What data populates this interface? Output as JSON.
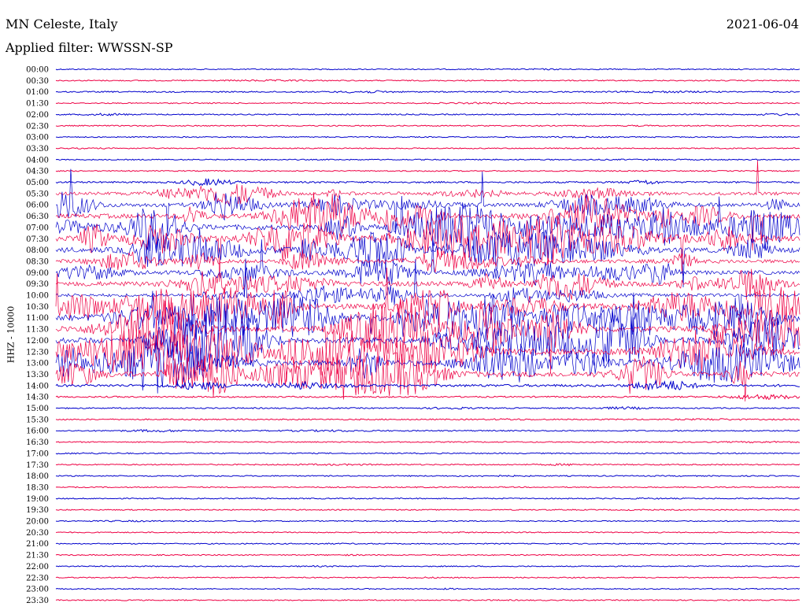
{
  "header": {
    "station": "MN Celeste, Italy",
    "filter": "Applied filter: WWSSN-SP",
    "date": "2021-06-04"
  },
  "chart_data": {
    "type": "line",
    "title": "MN Celeste, Italy",
    "subtitle": "Applied filter: WWSSN-SP",
    "date": "2021-06-04",
    "ylabel": "HHZ - 10000",
    "row_labels": [
      "00:00",
      "00:30",
      "01:00",
      "01:30",
      "02:00",
      "02:30",
      "03:00",
      "03:30",
      "04:00",
      "04:30",
      "05:00",
      "05:30",
      "06:00",
      "06:30",
      "07:00",
      "07:30",
      "08:00",
      "08:30",
      "09:00",
      "09:30",
      "10:00",
      "10:30",
      "11:00",
      "11:30",
      "12:00",
      "12:30",
      "13:00",
      "13:30",
      "14:00",
      "14:30",
      "15:00",
      "15:30",
      "16:00",
      "16:30",
      "17:00",
      "17:30",
      "18:00",
      "18:30",
      "19:00",
      "19:30",
      "20:00",
      "20:30",
      "21:00",
      "21:30",
      "22:00",
      "22:30",
      "23:00",
      "23:30"
    ],
    "row_activity": [
      0.02,
      0.03,
      0.06,
      0.02,
      0.05,
      0.03,
      0.02,
      0.02,
      0.02,
      0.02,
      0.15,
      0.45,
      0.6,
      0.75,
      0.9,
      0.9,
      0.85,
      0.55,
      0.6,
      0.8,
      0.45,
      0.95,
      1.0,
      1.0,
      1.0,
      1.0,
      0.95,
      0.9,
      0.3,
      0.1,
      0.05,
      0.05,
      0.05,
      0.03,
      0.03,
      0.04,
      0.03,
      0.02,
      0.03,
      0.02,
      0.03,
      0.02,
      0.02,
      0.02,
      0.02,
      0.02,
      0.02,
      0.02
    ],
    "colors": [
      "#0000cc",
      "#ee0044"
    ],
    "grid": false
  }
}
